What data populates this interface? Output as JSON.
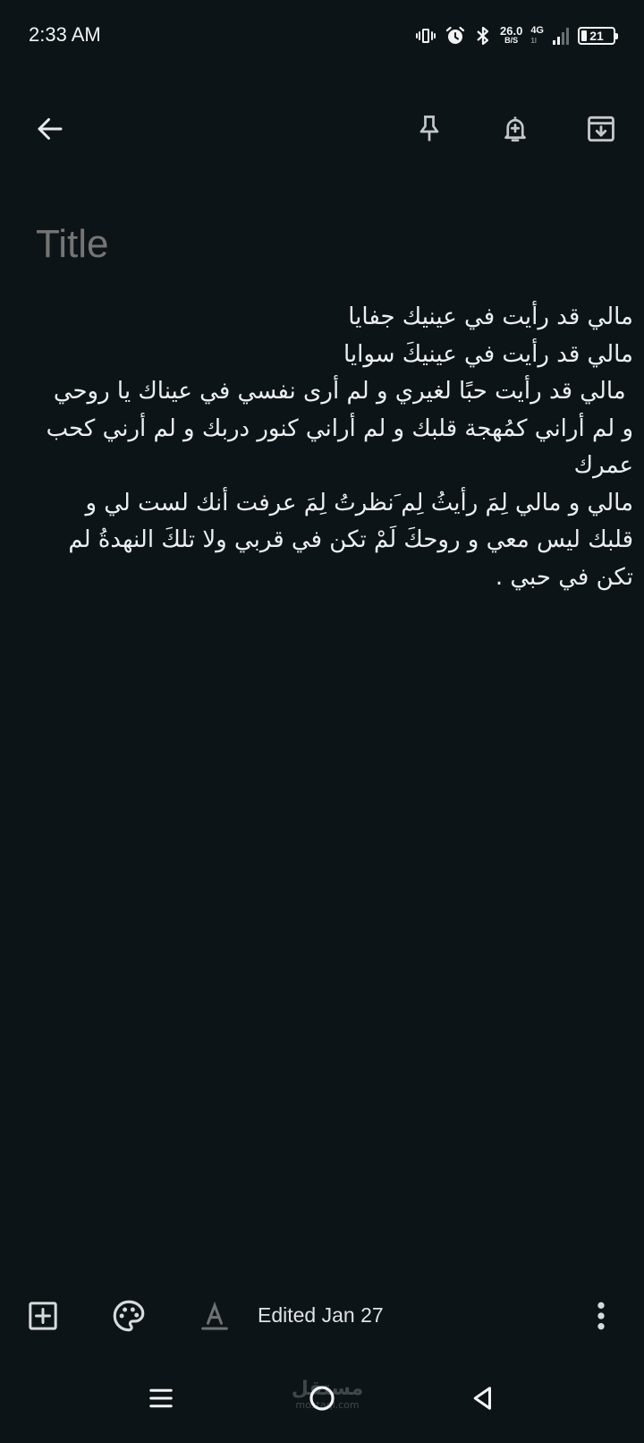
{
  "status_bar": {
    "time": "2:33 AM",
    "net_speed_value": "26.0",
    "net_speed_unit": "B/S",
    "network_type": "4G",
    "network_sub": "1l",
    "battery": "21",
    "icons": [
      "vibrate-icon",
      "alarm-icon",
      "bluetooth-icon",
      "signal-icon",
      "battery-icon"
    ]
  },
  "toolbar": {
    "back": "back-arrow-icon",
    "pin": "pin-icon",
    "reminder": "reminder-bell-icon",
    "archive": "archive-icon"
  },
  "note": {
    "title_placeholder": "Title",
    "body": "مالي قد رأيت في عينيك جفايا\nمالي قد رأيت في عينيكَ سوايا\n مالي قد رأيت حبًا لغيري و لم أرى نفسي في عيناك يا روحي\nو لم أراني كمُهجة قلبك و لم أراني كنور دربك و لم أرني كحب عمرك\nمالي و مالي لِمَ رأيثُ لِم َنظرتُ لِمَ عرفت أنك لست لي و قلبك ليس معي و روحكَ لَمْ تكن في قربي ولا تلكَ النهدةُ لم تكن في حبي ."
  },
  "bottom_bar": {
    "edited": "Edited Jan 27",
    "add": "add-box-icon",
    "palette": "palette-icon",
    "format": "text-format-icon",
    "more": "more-vert-icon"
  },
  "nav_bar": {
    "menu": "recent-apps-icon",
    "home": "home-icon",
    "back": "back-triangle-icon"
  },
  "watermark": {
    "arabic": "مستقل",
    "latin": "mostaql.com"
  }
}
